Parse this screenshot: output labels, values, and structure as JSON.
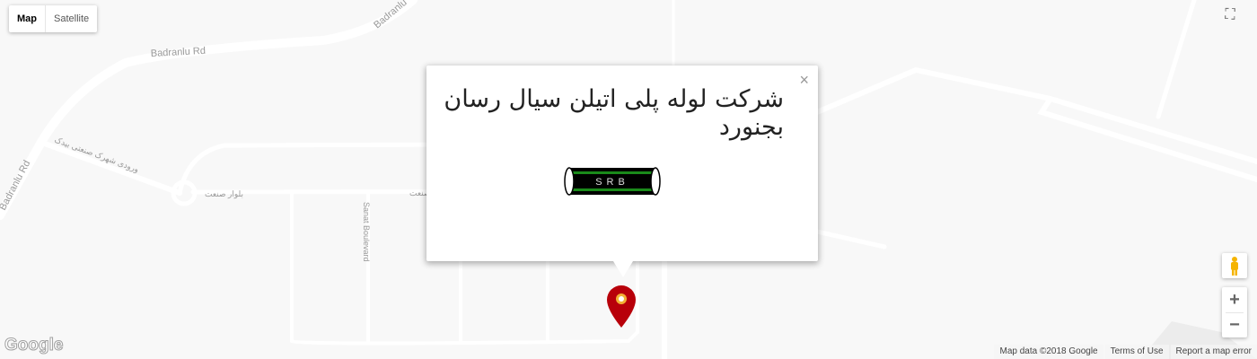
{
  "map_type": {
    "map": "Map",
    "satellite": "Satellite",
    "active": "Map"
  },
  "road_labels": {
    "badranlu_top": "Badranlu Rd",
    "badranlu_top2": "Badranlu",
    "badranlu_left": "Badranlu Rd",
    "entrance": "ورودی شهرک صنعتی بیدک",
    "sanat_blvd_fa": "بلوار صنعت",
    "sanat_blvd_fa2": "صنعت",
    "sanat_blvd": "Sanat Boulevard"
  },
  "infowindow": {
    "title": "شرکت لوله پلی اتیلن سیال رسان بجنورد",
    "logo_text": "SRB",
    "close": "×"
  },
  "controls": {
    "fullscreen": "⛶",
    "zoom_in": "+",
    "zoom_out": "−"
  },
  "footer": {
    "map_data": "Map data ©2018 Google",
    "terms": "Terms of Use",
    "report": "Report a map error"
  },
  "logo": "Google",
  "colors": {
    "pin": "#b8000a",
    "pipe_green": "#1a8a1a"
  }
}
